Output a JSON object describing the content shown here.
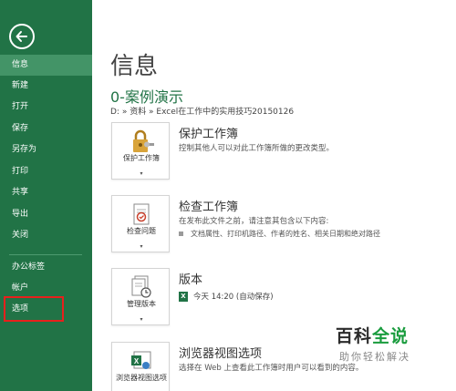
{
  "sidebar": {
    "items": [
      {
        "label": "信息"
      },
      {
        "label": "新建"
      },
      {
        "label": "打开"
      },
      {
        "label": "保存"
      },
      {
        "label": "另存为"
      },
      {
        "label": "打印"
      },
      {
        "label": "共享"
      },
      {
        "label": "导出"
      },
      {
        "label": "关闭"
      },
      {
        "label": "办公标签"
      },
      {
        "label": "帐户"
      },
      {
        "label": "选项"
      }
    ]
  },
  "main": {
    "page_title": "信息",
    "doc_title": "0-案例演示",
    "doc_path": "D: » 资料 » Excel在工作中的实用技巧20150126",
    "sections": [
      {
        "tile_label": "保护工作簿",
        "tile_icon": "lock-key-icon",
        "heading": "保护工作簿",
        "desc": "控制其他人可以对此工作簿所做的更改类型。"
      },
      {
        "tile_label": "检查问题",
        "tile_icon": "inspect-document-icon",
        "heading": "检查工作簿",
        "desc": "在发布此文件之前，请注意其包含以下内容:",
        "bullet": "文档属性、打印机路径、作者的姓名、相关日期和绝对路径"
      },
      {
        "tile_label": "管理版本",
        "tile_icon": "manage-versions-icon",
        "heading": "版本",
        "version_entry": "今天 14:20 (自动保存)"
      },
      {
        "tile_label": "浏览器视图选项",
        "tile_icon": "browser-view-icon",
        "heading": "浏览器视图选项",
        "desc": "选择在 Web 上查看此工作簿时用户可以看到的内容。"
      }
    ]
  },
  "watermark": {
    "title_part1": "百科",
    "title_part2": "全说",
    "subtitle": "助你轻松解决"
  },
  "colors": {
    "sidebar_bg": "#217346",
    "active_item_bg": "#439467",
    "highlight_border": "#e8201c"
  }
}
